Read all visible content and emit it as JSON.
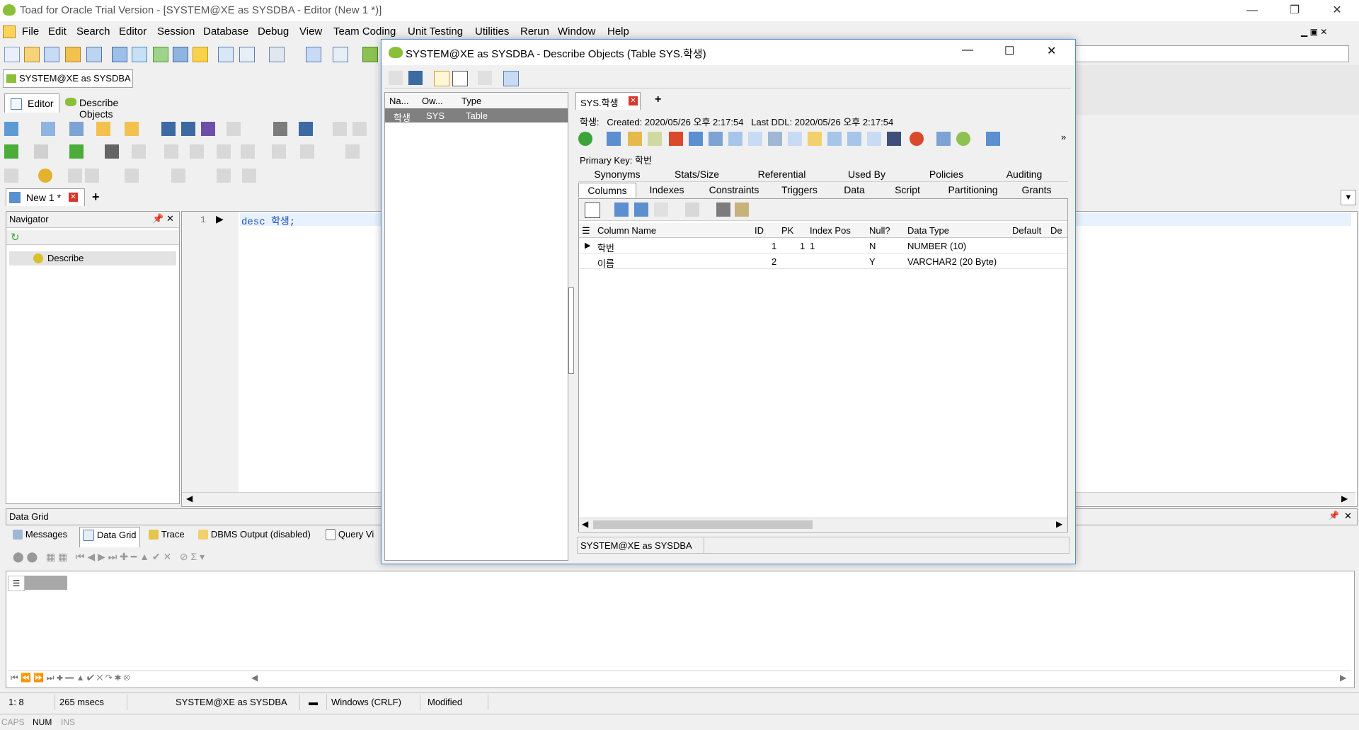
{
  "app": {
    "title": "Toad for Oracle Trial Version - [SYSTEM@XE as SYSDBA - Editor (New 1 *)]"
  },
  "menu": [
    "File",
    "Edit",
    "Search",
    "Editor",
    "Session",
    "Database",
    "Debug",
    "View",
    "Team Coding",
    "Unit Testing",
    "Utilities",
    "Rerun",
    "Window",
    "Help"
  ],
  "connection_tab": "SYSTEM@XE as SYSDBA",
  "doc_tabs": {
    "editor": "Editor",
    "describe": "Describe Objects"
  },
  "editor_tab": {
    "label": "New 1 *",
    "add": "+"
  },
  "navigator": {
    "title": "Navigator",
    "item": "Describe"
  },
  "editor": {
    "line_no": "1",
    "code_kw": "desc",
    "code_rest": " 학생;"
  },
  "datagrid": {
    "title": "Data Grid",
    "tabs": [
      "Messages",
      "Data Grid",
      "Trace",
      "DBMS Output (disabled)",
      "Query Vi"
    ]
  },
  "status": {
    "pos": "1:  8",
    "time": "265 msecs",
    "conn": "SYSTEM@XE as SYSDBA",
    "eol": "Windows (CRLF)",
    "state": "Modified"
  },
  "keys": {
    "caps": "CAPS",
    "num": "NUM",
    "ins": "INS"
  },
  "dialog": {
    "title": "SYSTEM@XE as SYSDBA - Describe Objects (Table SYS.학생)",
    "list_headers": [
      "Na...",
      "Ow...",
      "Type"
    ],
    "list_row": [
      "학생",
      "SYS",
      "Table"
    ],
    "obj_tab": "SYS.학생",
    "info": "학생:   Created: 2020/05/26 오후 2:17:54   Last DDL: 2020/05/26 오후 2:17:54",
    "pk_label": "Primary Key:",
    "pk_value": "학번",
    "tabs_row1": [
      "Synonyms",
      "Stats/Size",
      "Referential",
      "Used By",
      "Policies",
      "Auditing"
    ],
    "tabs_row2": [
      "Columns",
      "Indexes",
      "Constraints",
      "Triggers",
      "Data",
      "Script",
      "Partitioning",
      "Grants"
    ],
    "grid_headers": [
      "Column Name",
      "ID",
      "PK",
      "Index Pos",
      "Null?",
      "Data Type",
      "Default",
      "De"
    ],
    "rows": [
      [
        "학번",
        "1",
        "1",
        "1",
        "N",
        "NUMBER (10)",
        ""
      ],
      [
        "이름",
        "2",
        "",
        "",
        "Y",
        "VARCHAR2 (20 Byte)",
        ""
      ]
    ],
    "status": "SYSTEM@XE as SYSDBA"
  }
}
